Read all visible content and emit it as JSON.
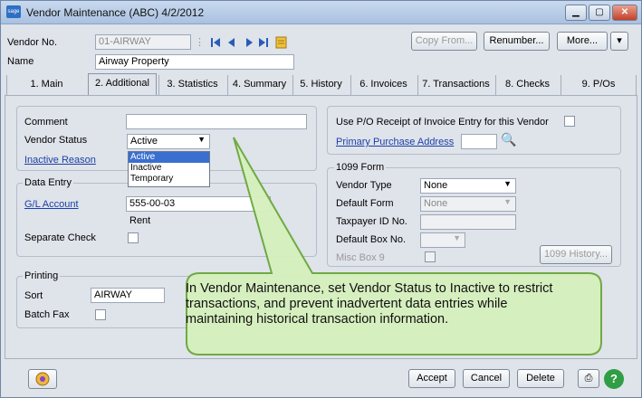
{
  "window": {
    "title": "Vendor Maintenance (ABC) 4/2/2012",
    "logo_text": "sage"
  },
  "header": {
    "vendor_no_label": "Vendor No.",
    "vendor_no_value": "01-AIRWAY",
    "name_label": "Name",
    "name_value": "Airway Property",
    "copy_from": "Copy From...",
    "renumber": "Renumber...",
    "more": "More..."
  },
  "tabs": [
    {
      "label": "1. Main"
    },
    {
      "label": "2. Additional"
    },
    {
      "label": "3. Statistics"
    },
    {
      "label": "4. Summary"
    },
    {
      "label": "5. History"
    },
    {
      "label": "6. Invoices"
    },
    {
      "label": "7. Transactions"
    },
    {
      "label": "8. Checks"
    },
    {
      "label": "9. P/Os"
    }
  ],
  "left": {
    "comment_label": "Comment",
    "vendor_status_label": "Vendor Status",
    "vendor_status_value": "Active",
    "status_options": [
      "Active",
      "Inactive",
      "Temporary"
    ],
    "inactive_reason": "Inactive Reason",
    "data_entry_title": "Data Entry",
    "gl_account_label": "G/L Account",
    "gl_account_value": "555-00-03",
    "gl_account_desc": "Rent",
    "separate_check_label": "Separate Check",
    "printing_title": "Printing",
    "sort_label": "Sort",
    "sort_value": "AIRWAY",
    "batch_fax_label": "Batch Fax"
  },
  "right": {
    "use_po_label": "Use P/O Receipt of Invoice Entry for this Vendor",
    "primary_address": "Primary Purchase Address",
    "form_title": "1099 Form",
    "vendor_type_label": "Vendor Type",
    "vendor_type_value": "None",
    "default_form_label": "Default Form",
    "default_form_value": "None",
    "taxpayer_label": "Taxpayer ID No.",
    "default_box_label": "Default Box No.",
    "misc_box_label": "Misc Box 9",
    "history_button": "1099 History..."
  },
  "footer": {
    "accept": "Accept",
    "cancel": "Cancel",
    "delete": "Delete"
  },
  "callout": {
    "text": "In Vendor Maintenance, set Vendor Status to Inactive to restrict transactions, and prevent inadvertent data entries while maintaining historical transaction information."
  },
  "colors": {
    "callout_fill": "#d6f0bd",
    "callout_border": "#6aa83c",
    "link": "#1a3fa8"
  }
}
